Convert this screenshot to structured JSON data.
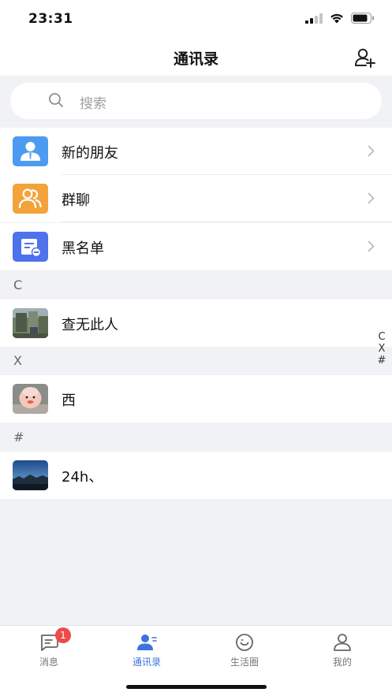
{
  "status_bar": {
    "time": "23:31"
  },
  "nav": {
    "title": "通讯录",
    "add_icon": "add-user-icon"
  },
  "search": {
    "placeholder": "搜索"
  },
  "menu": [
    {
      "label": "新的朋友",
      "icon": "new-friend-icon",
      "color": "#4c9bf1"
    },
    {
      "label": "群聊",
      "icon": "group-chat-icon",
      "color": "#f2a33a"
    },
    {
      "label": "黑名单",
      "icon": "blacklist-icon",
      "color": "#4e71ec"
    }
  ],
  "sections": [
    {
      "letter": "C",
      "contacts": [
        {
          "name": "查无此人",
          "avatar": "avatar-photo"
        }
      ]
    },
    {
      "letter": "X",
      "contacts": [
        {
          "name": "西",
          "avatar": "avatar-photo"
        }
      ]
    },
    {
      "letter": "#",
      "contacts": [
        {
          "name": "24h、",
          "avatar": "avatar-photo"
        }
      ]
    }
  ],
  "index": [
    "C",
    "X",
    "#"
  ],
  "tabs": [
    {
      "label": "消息",
      "icon": "message-icon",
      "badge": "1",
      "active": false
    },
    {
      "label": "通讯录",
      "icon": "contacts-icon",
      "active": true
    },
    {
      "label": "生活圈",
      "icon": "moments-icon",
      "active": false
    },
    {
      "label": "我的",
      "icon": "profile-icon",
      "active": false
    }
  ],
  "colors": {
    "accent": "#3d72e0",
    "badge": "#ee4a4a",
    "background": "#f1f2f5"
  }
}
